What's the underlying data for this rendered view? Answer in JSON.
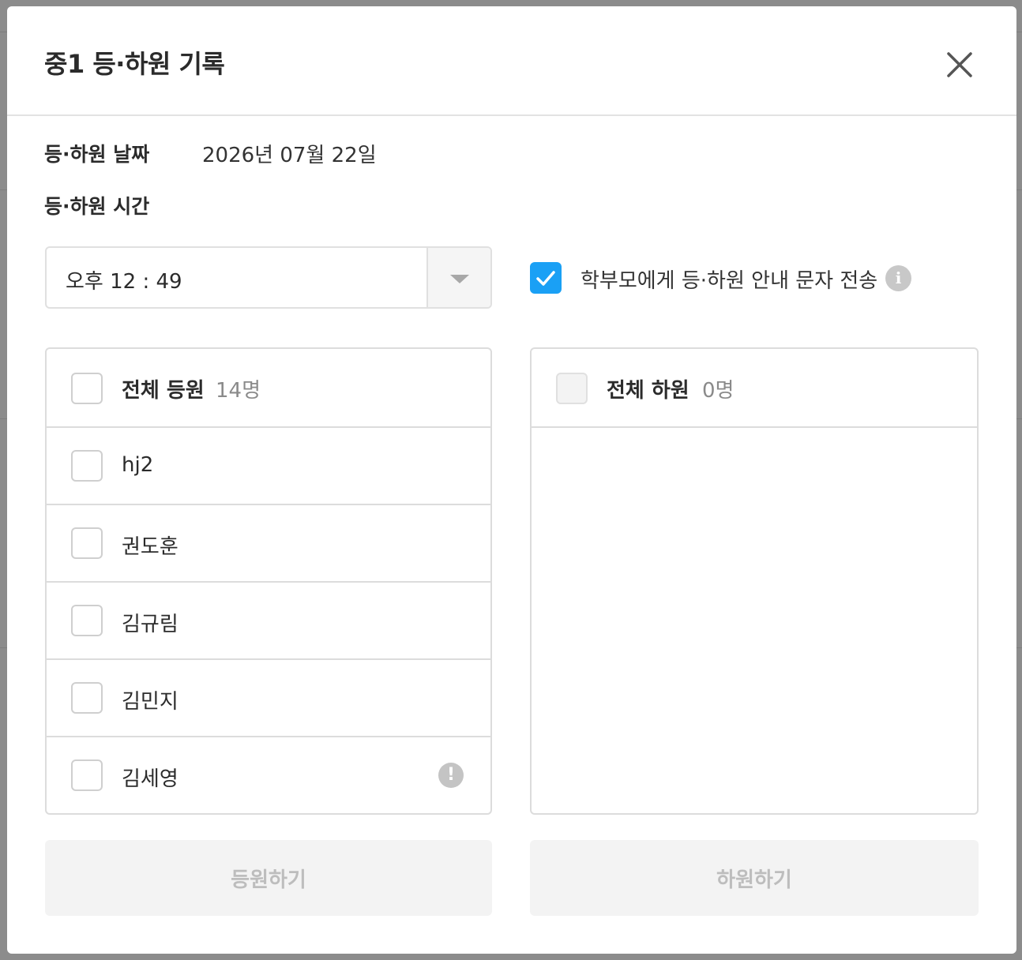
{
  "modal": {
    "title": "중1 등·하원 기록"
  },
  "date_row": {
    "label": "등·하원 날짜",
    "value": "2026년 07월 22일"
  },
  "time_row": {
    "label": "등·하원 시간",
    "selected": "오후 12 : 49"
  },
  "sms": {
    "checked": true,
    "label": "학부모에게 등·하원 안내 문자 전송"
  },
  "check_in_panel": {
    "title": "전체 등원",
    "count": "14명",
    "students": [
      {
        "name": "hj2",
        "warning": false
      },
      {
        "name": "권도훈",
        "warning": false
      },
      {
        "name": "김규림",
        "warning": false
      },
      {
        "name": "김민지",
        "warning": false
      },
      {
        "name": "김세영",
        "warning": true
      }
    ]
  },
  "check_out_panel": {
    "title": "전체 하원",
    "count": "0명"
  },
  "buttons": {
    "check_in": "등원하기",
    "check_out": "하원하기"
  },
  "colors": {
    "accent": "#1aa0f5",
    "disabled_bg": "#f3f3f3",
    "disabled_text": "#bdbdbd"
  }
}
